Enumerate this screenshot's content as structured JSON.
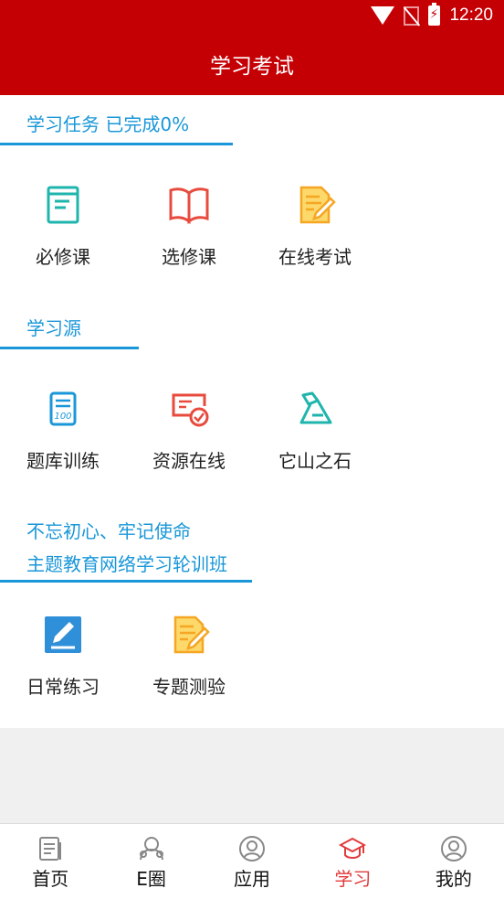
{
  "status_bar": {
    "time": "12:20"
  },
  "header": {
    "title": "学习考试"
  },
  "sections": [
    {
      "title": "学习任务   已完成0%",
      "items": [
        {
          "label": "必修课",
          "icon": "book-icon"
        },
        {
          "label": "选修课",
          "icon": "open-book-icon"
        },
        {
          "label": "在线考试",
          "icon": "exam-paper-icon"
        }
      ]
    },
    {
      "title": "学习源",
      "items": [
        {
          "label": "题库训练",
          "icon": "score-100-icon"
        },
        {
          "label": "资源在线",
          "icon": "screen-check-icon"
        },
        {
          "label": "它山之石",
          "icon": "stone-icon"
        }
      ]
    },
    {
      "title_line1": "不忘初心、牢记使命",
      "title_line2": "主题教育网络学习轮训班",
      "items": [
        {
          "label": "日常练习",
          "icon": "pen-square-icon"
        },
        {
          "label": "专题测验",
          "icon": "quiz-paper-icon"
        }
      ]
    }
  ],
  "bottom_nav": [
    {
      "label": "首页",
      "icon": "home-doc-icon"
    },
    {
      "label": "E圈",
      "icon": "circle-people-icon"
    },
    {
      "label": "应用",
      "icon": "apps-user-icon"
    },
    {
      "label": "学习",
      "icon": "graduation-cap-icon",
      "active": true
    },
    {
      "label": "我的",
      "icon": "profile-icon"
    }
  ],
  "colors": {
    "primary_red": "#c50004",
    "section_blue": "#1a97d8",
    "teal": "#1fb5ad",
    "red_icon": "#e84b3d",
    "orange_icon": "#f5a623",
    "nav_active": "#e23b3b"
  }
}
